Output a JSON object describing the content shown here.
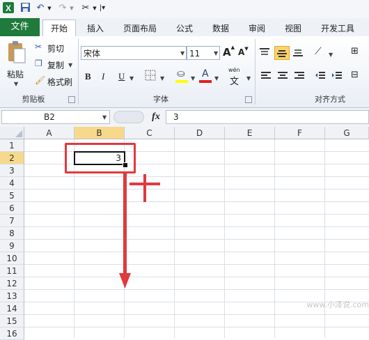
{
  "quick_access": {
    "excel_logo": "excel-logo",
    "save_icon": "save-icon",
    "undo_icon": "undo-icon",
    "redo_icon": "redo-icon",
    "tools_icon": "tools-icon",
    "customize_icon": "customize-icon"
  },
  "tabs": [
    {
      "label": "文件"
    },
    {
      "label": "开始"
    },
    {
      "label": "插入"
    },
    {
      "label": "页面布局"
    },
    {
      "label": "公式"
    },
    {
      "label": "数据"
    },
    {
      "label": "审阅"
    },
    {
      "label": "视图"
    },
    {
      "label": "开发工具"
    }
  ],
  "ribbon": {
    "clipboard": {
      "paste_label": "粘贴",
      "cut_label": "剪切",
      "copy_label": "复制",
      "format_painter_label": "格式刷",
      "group_label": "剪贴板"
    },
    "font": {
      "font_name": "宋体",
      "font_size": "11",
      "bold": "B",
      "italic": "I",
      "underline": "U",
      "grow_font": "A",
      "shrink_font": "A",
      "font_color": "A",
      "phonetic": "wén",
      "phonetic_char": "文",
      "group_label": "字体"
    },
    "alignment": {
      "group_label": "对齐方式"
    }
  },
  "formula_bar": {
    "name_box": "B2",
    "fx_label": "fx",
    "value": "3"
  },
  "sheet": {
    "columns": [
      "A",
      "B",
      "C",
      "D",
      "E",
      "F",
      "G"
    ],
    "rows": [
      "1",
      "2",
      "3",
      "4",
      "5",
      "6",
      "7",
      "8",
      "9",
      "10",
      "11",
      "12",
      "13",
      "14",
      "15",
      "16"
    ],
    "active_cell": "B2",
    "active_value": "3"
  },
  "annotation": {
    "plus_sign": "+",
    "highlight_color": "#e0393e"
  },
  "watermark": "www.小泽说.com"
}
